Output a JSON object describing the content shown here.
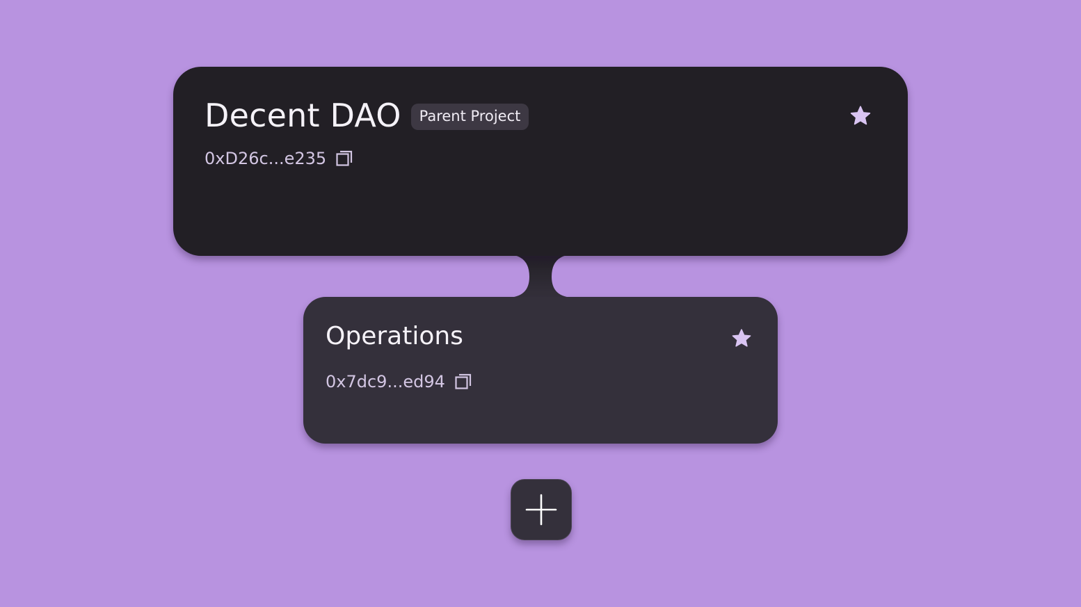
{
  "background_color": "#b893e0",
  "parent_node": {
    "title": "Decent DAO",
    "badge": "Parent Project",
    "address": "0xD26c...e235",
    "favorite_icon": "star-icon",
    "copy_icon": "copy-icon"
  },
  "child_node": {
    "title": "Operations",
    "address": "0x7dc9...ed94",
    "favorite_icon": "star-icon",
    "copy_icon": "copy-icon"
  },
  "add_button": {
    "icon": "plus-icon"
  },
  "colors": {
    "parent_card": "#221f25",
    "child_card": "#34303b",
    "star": "#d9c4f2",
    "address_text": "#d3c6e3"
  }
}
